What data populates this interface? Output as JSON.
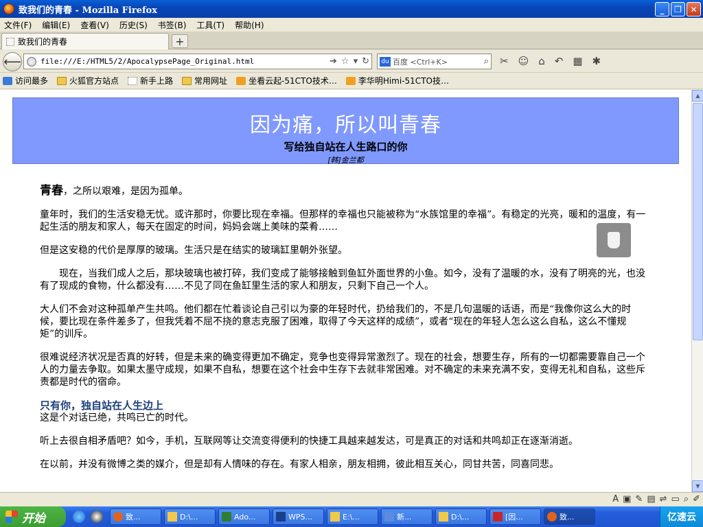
{
  "window": {
    "title": "致我们的青春 - Mozilla Firefox",
    "minimize": "_",
    "maximize": "❐",
    "close": "✕"
  },
  "menu": [
    "文件(F)",
    "编辑(E)",
    "查看(V)",
    "历史(S)",
    "书签(B)",
    "工具(T)",
    "帮助(H)"
  ],
  "tab": {
    "title": "致我们的青春",
    "new_tab": "+"
  },
  "nav": {
    "url": "file:///E:/HTML5/2/ApocalypsePage_Original.html",
    "search_engine": "百度",
    "search_placeholder": "百度 <Ctrl+K>"
  },
  "bookmarks": [
    {
      "label": "访问最多",
      "icon": "visit-icon"
    },
    {
      "label": "火狐官方站点",
      "icon": "folder-icon"
    },
    {
      "label": "新手上路",
      "icon": "page-icon"
    },
    {
      "label": "常用网址",
      "icon": "folder-icon"
    },
    {
      "label": "坐看云起-51CTO技术…",
      "icon": "rss-icon"
    },
    {
      "label": "李华明Himi-51CTO技…",
      "icon": "rss-icon"
    }
  ],
  "page": {
    "header": {
      "title": "因为痛，所以叫青春",
      "subtitle": "写给独自站在人生路口的你",
      "author": "[韩]金兰都"
    },
    "lead_word": "青春",
    "lead_rest": "，之所以艰难，是因为孤单。",
    "p1": "童年时，我们的生活安稳无忧。或许那时，你要比现在幸福。但那样的幸福也只能被称为“水族馆里的幸福”。有稳定的光亮，暖和的温度，有一起生活的朋友和家人，每天在固定的时间，妈妈会端上美味的菜肴……",
    "p2": "但是这安稳的代价是厚厚的玻璃。生活只是在结实的玻璃缸里朝外张望。",
    "p3": "现在，当我们成人之后，那块玻璃也被打碎，我们变成了能够接触到鱼缸外面世界的小鱼。如今，没有了温暖的水，没有了明亮的光，也没有了现成的食物，什么都没有……不见了同在鱼缸里生活的家人和朋友，只剩下自己一个人。",
    "p4": "大人们不会对这种孤单产生共鸣。他们都在忙着谈论自己引以为豪的年轻时代，扔给我们的，不是几句温暖的话语，而是“我像你这么大的时候，要比现在条件差多了，但我凭着不屈不挠的意志克服了困难，取得了今天这样的成绩”，或者“现在的年轻人怎么这么自私，这么不懂规矩”的训斥。",
    "p5": "很难说经济状况是否真的好转，但是未来的确变得更加不确定，竞争也变得异常激烈了。现在的社会，想要生存，所有的一切都需要靠自己一个人的力量去争取。如果太墨守成规，如果不自私，想要在这个社会中生存下去就非常困难。对不确定的未来充满不安，变得无礼和自私，这些斥责都是时代的宿命。",
    "sub_heading": "只有你，独自站在人生边上",
    "p6": "这是个对话已绝，共鸣已亡的时代。",
    "p7": "听上去很自相矛盾吧？如今，手机，互联网等让交流变得便利的快捷工具越来越发达，可是真正的对话和共鸣却正在逐渐消逝。",
    "p8": "在以前，并没有微博之类的媒介，但是却有人情味的存在。有家人相亲，朋友相拥，彼此相互关心，同甘共苦，同喜同悲。"
  },
  "taskbar": {
    "start": "开始",
    "tasks": [
      "致...",
      "D:\\...",
      "Ado...",
      "WPS...",
      "E:\\...",
      "新...",
      "D:\\...",
      "[因...",
      "致..."
    ],
    "tray_text": "亿速云"
  },
  "colors": {
    "header_bg": "#8099ff",
    "subheading": "#1d3e7a",
    "taskbar": "#245edb",
    "start": "#3b9c32"
  }
}
